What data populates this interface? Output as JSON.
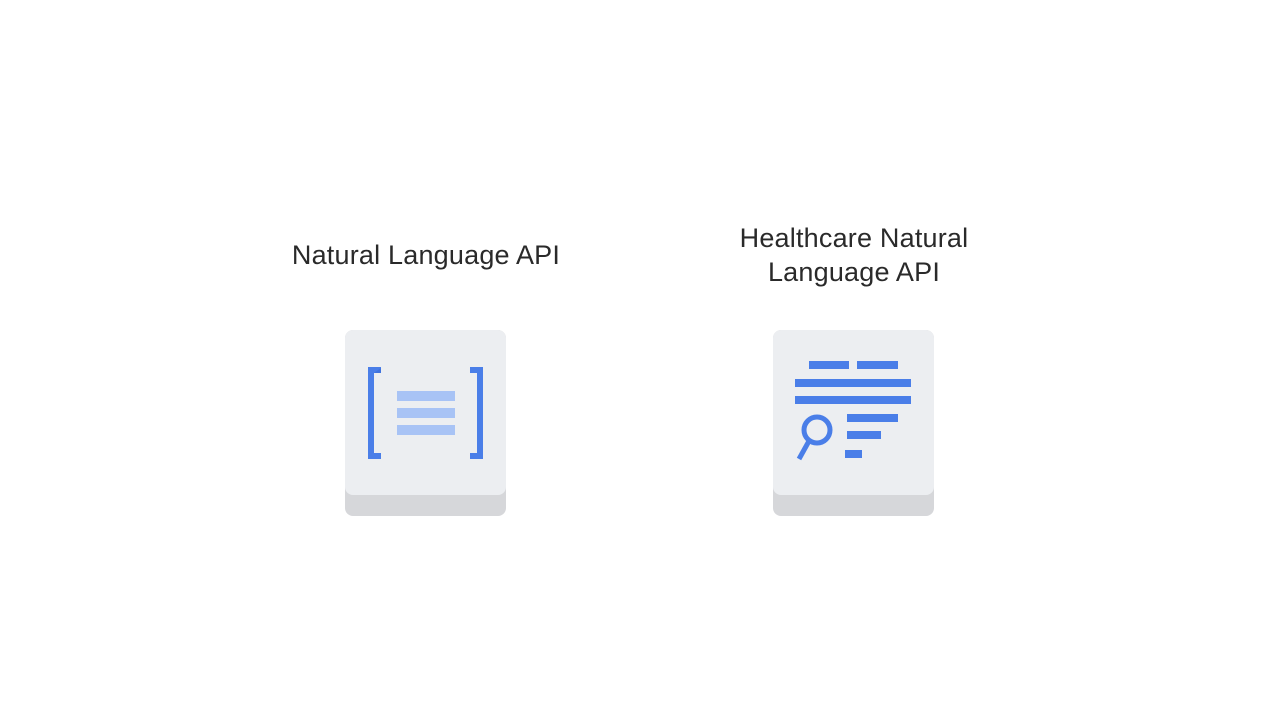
{
  "products": [
    {
      "title": "Natural Language API",
      "icon": "bracketed-text-icon"
    },
    {
      "title": "Healthcare Natural\nLanguage API",
      "icon": "text-search-icon"
    }
  ],
  "colors": {
    "background": "#ffffff",
    "tile_face": "#eceef1",
    "tile_shadow": "#d6d7da",
    "blue": "#4a7ee8",
    "light_blue": "#a8c3f5",
    "text": "#2a2a2a"
  }
}
